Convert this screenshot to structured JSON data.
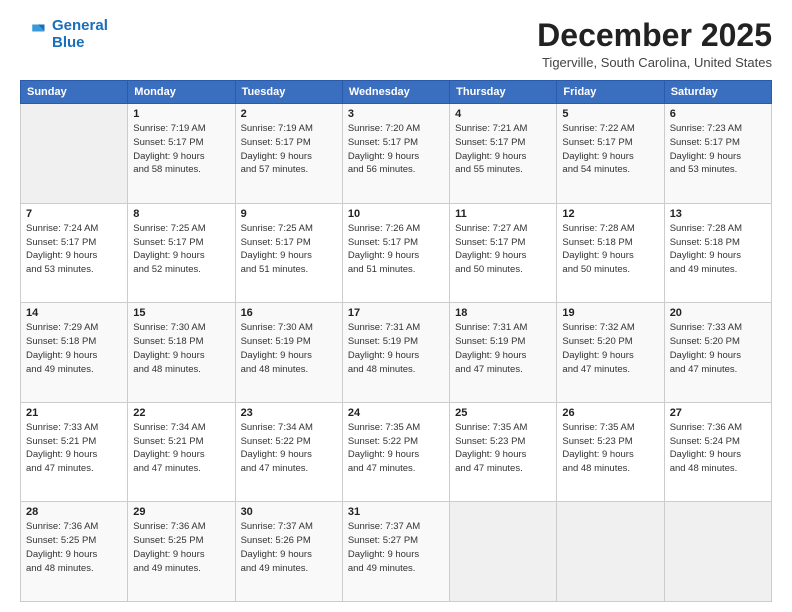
{
  "header": {
    "logo_line1": "General",
    "logo_line2": "Blue",
    "title": "December 2025",
    "subtitle": "Tigerville, South Carolina, United States"
  },
  "weekdays": [
    "Sunday",
    "Monday",
    "Tuesday",
    "Wednesday",
    "Thursday",
    "Friday",
    "Saturday"
  ],
  "weeks": [
    [
      {
        "day": "",
        "info": ""
      },
      {
        "day": "1",
        "info": "Sunrise: 7:19 AM\nSunset: 5:17 PM\nDaylight: 9 hours\nand 58 minutes."
      },
      {
        "day": "2",
        "info": "Sunrise: 7:19 AM\nSunset: 5:17 PM\nDaylight: 9 hours\nand 57 minutes."
      },
      {
        "day": "3",
        "info": "Sunrise: 7:20 AM\nSunset: 5:17 PM\nDaylight: 9 hours\nand 56 minutes."
      },
      {
        "day": "4",
        "info": "Sunrise: 7:21 AM\nSunset: 5:17 PM\nDaylight: 9 hours\nand 55 minutes."
      },
      {
        "day": "5",
        "info": "Sunrise: 7:22 AM\nSunset: 5:17 PM\nDaylight: 9 hours\nand 54 minutes."
      },
      {
        "day": "6",
        "info": "Sunrise: 7:23 AM\nSunset: 5:17 PM\nDaylight: 9 hours\nand 53 minutes."
      }
    ],
    [
      {
        "day": "7",
        "info": "Sunrise: 7:24 AM\nSunset: 5:17 PM\nDaylight: 9 hours\nand 53 minutes."
      },
      {
        "day": "8",
        "info": "Sunrise: 7:25 AM\nSunset: 5:17 PM\nDaylight: 9 hours\nand 52 minutes."
      },
      {
        "day": "9",
        "info": "Sunrise: 7:25 AM\nSunset: 5:17 PM\nDaylight: 9 hours\nand 51 minutes."
      },
      {
        "day": "10",
        "info": "Sunrise: 7:26 AM\nSunset: 5:17 PM\nDaylight: 9 hours\nand 51 minutes."
      },
      {
        "day": "11",
        "info": "Sunrise: 7:27 AM\nSunset: 5:17 PM\nDaylight: 9 hours\nand 50 minutes."
      },
      {
        "day": "12",
        "info": "Sunrise: 7:28 AM\nSunset: 5:18 PM\nDaylight: 9 hours\nand 50 minutes."
      },
      {
        "day": "13",
        "info": "Sunrise: 7:28 AM\nSunset: 5:18 PM\nDaylight: 9 hours\nand 49 minutes."
      }
    ],
    [
      {
        "day": "14",
        "info": "Sunrise: 7:29 AM\nSunset: 5:18 PM\nDaylight: 9 hours\nand 49 minutes."
      },
      {
        "day": "15",
        "info": "Sunrise: 7:30 AM\nSunset: 5:18 PM\nDaylight: 9 hours\nand 48 minutes."
      },
      {
        "day": "16",
        "info": "Sunrise: 7:30 AM\nSunset: 5:19 PM\nDaylight: 9 hours\nand 48 minutes."
      },
      {
        "day": "17",
        "info": "Sunrise: 7:31 AM\nSunset: 5:19 PM\nDaylight: 9 hours\nand 48 minutes."
      },
      {
        "day": "18",
        "info": "Sunrise: 7:31 AM\nSunset: 5:19 PM\nDaylight: 9 hours\nand 47 minutes."
      },
      {
        "day": "19",
        "info": "Sunrise: 7:32 AM\nSunset: 5:20 PM\nDaylight: 9 hours\nand 47 minutes."
      },
      {
        "day": "20",
        "info": "Sunrise: 7:33 AM\nSunset: 5:20 PM\nDaylight: 9 hours\nand 47 minutes."
      }
    ],
    [
      {
        "day": "21",
        "info": "Sunrise: 7:33 AM\nSunset: 5:21 PM\nDaylight: 9 hours\nand 47 minutes."
      },
      {
        "day": "22",
        "info": "Sunrise: 7:34 AM\nSunset: 5:21 PM\nDaylight: 9 hours\nand 47 minutes."
      },
      {
        "day": "23",
        "info": "Sunrise: 7:34 AM\nSunset: 5:22 PM\nDaylight: 9 hours\nand 47 minutes."
      },
      {
        "day": "24",
        "info": "Sunrise: 7:35 AM\nSunset: 5:22 PM\nDaylight: 9 hours\nand 47 minutes."
      },
      {
        "day": "25",
        "info": "Sunrise: 7:35 AM\nSunset: 5:23 PM\nDaylight: 9 hours\nand 47 minutes."
      },
      {
        "day": "26",
        "info": "Sunrise: 7:35 AM\nSunset: 5:23 PM\nDaylight: 9 hours\nand 48 minutes."
      },
      {
        "day": "27",
        "info": "Sunrise: 7:36 AM\nSunset: 5:24 PM\nDaylight: 9 hours\nand 48 minutes."
      }
    ],
    [
      {
        "day": "28",
        "info": "Sunrise: 7:36 AM\nSunset: 5:25 PM\nDaylight: 9 hours\nand 48 minutes."
      },
      {
        "day": "29",
        "info": "Sunrise: 7:36 AM\nSunset: 5:25 PM\nDaylight: 9 hours\nand 49 minutes."
      },
      {
        "day": "30",
        "info": "Sunrise: 7:37 AM\nSunset: 5:26 PM\nDaylight: 9 hours\nand 49 minutes."
      },
      {
        "day": "31",
        "info": "Sunrise: 7:37 AM\nSunset: 5:27 PM\nDaylight: 9 hours\nand 49 minutes."
      },
      {
        "day": "",
        "info": ""
      },
      {
        "day": "",
        "info": ""
      },
      {
        "day": "",
        "info": ""
      }
    ]
  ]
}
